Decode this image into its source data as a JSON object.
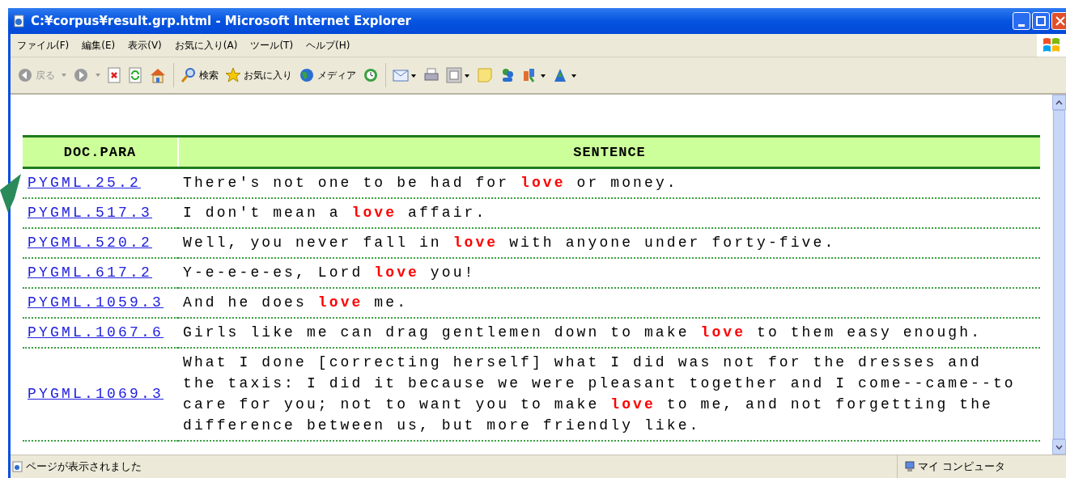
{
  "window": {
    "title": "C:¥corpus¥result.grp.html - Microsoft Internet Explorer"
  },
  "menu": [
    "ファイル(F)",
    "編集(E)",
    "表示(V)",
    "お気に入り(A)",
    "ツール(T)",
    "ヘルプ(H)"
  ],
  "toolbar": [
    {
      "kind": "back",
      "label": "戻る",
      "disabled": true
    },
    {
      "kind": "forward",
      "disabled": true
    },
    {
      "kind": "stop"
    },
    {
      "kind": "refresh"
    },
    {
      "kind": "home"
    },
    {
      "kind": "sep"
    },
    {
      "kind": "search",
      "label": "検索"
    },
    {
      "kind": "favorites",
      "label": "お気に入り"
    },
    {
      "kind": "media",
      "label": "メディア"
    },
    {
      "kind": "history"
    },
    {
      "kind": "sep"
    },
    {
      "kind": "mail"
    },
    {
      "kind": "print"
    },
    {
      "kind": "edit"
    },
    {
      "kind": "note"
    },
    {
      "kind": "messenger"
    },
    {
      "kind": "research"
    },
    {
      "kind": "tools"
    }
  ],
  "table": {
    "columns": [
      "DOC.PARA",
      "SENTENCE"
    ],
    "rows": [
      {
        "doc": "PYGML.25.2",
        "sentence": "There's not one to be had for **love** or money."
      },
      {
        "doc": "PYGML.517.3",
        "sentence": "I don't mean a **love** affair."
      },
      {
        "doc": "PYGML.520.2",
        "sentence": "Well, you never fall in **love** with anyone under forty-five."
      },
      {
        "doc": "PYGML.617.2",
        "sentence": "Y-e-e-e-es, Lord **love** you!"
      },
      {
        "doc": "PYGML.1059.3",
        "sentence": "And he does **love** me."
      },
      {
        "doc": "PYGML.1067.6",
        "sentence": "Girls like me can drag gentlemen down to make **love** to them easy enough."
      },
      {
        "doc": "PYGML.1069.3",
        "sentence": "What I done [correcting herself] what I did was not for the dresses and the taxis: I did it because we were pleasant together and I come--came--to care for you; not to want you to make **love** to me, and not forgetting the difference between us, but more friendly like."
      }
    ]
  },
  "status_bar": {
    "message": "ページが表示されました",
    "zone": "マイ コンピュータ"
  }
}
